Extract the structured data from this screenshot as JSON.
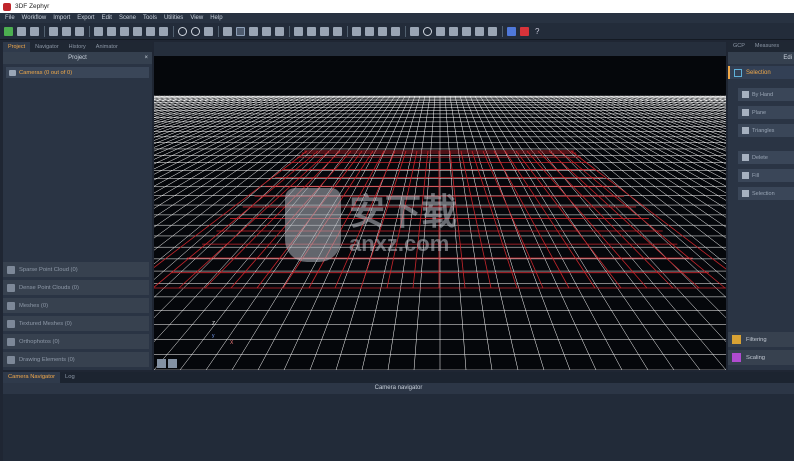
{
  "window": {
    "title": "3DF Zephyr"
  },
  "menu": [
    "File",
    "Workflow",
    "Import",
    "Export",
    "Edit",
    "Scene",
    "Tools",
    "Utilities",
    "View",
    "Help"
  ],
  "left_panel": {
    "tabs": [
      "Project",
      "Navigator",
      "History",
      "Animator"
    ],
    "active_tab": "Project",
    "title": "Project",
    "close": "×",
    "camera_item": "Cameras (0 out of 0)",
    "items": [
      {
        "label": "Sparse Point Cloud (0)",
        "icon": "sparse-cloud-icon"
      },
      {
        "label": "Dense Point Clouds (0)",
        "icon": "dense-cloud-icon"
      },
      {
        "label": "Meshes (0)",
        "icon": "mesh-icon"
      },
      {
        "label": "Textured Meshes (0)",
        "icon": "textured-mesh-icon"
      },
      {
        "label": "Orthophotos (0)",
        "icon": "orthophoto-icon"
      },
      {
        "label": "Drawing Elements (0)",
        "icon": "drawing-icon"
      }
    ]
  },
  "right_panel": {
    "tabs": [
      "GCP",
      "Measures"
    ],
    "header": "Edi",
    "selection_label": "Selection",
    "buttons_a": [
      "By Hand",
      "Plane",
      "Triangles"
    ],
    "buttons_b": [
      "Delete",
      "Fill",
      "Selection"
    ],
    "bottom": [
      "Filtering",
      "Scaling"
    ]
  },
  "viewport": {
    "axes": {
      "z": "Z",
      "y": "y",
      "x": "X"
    }
  },
  "bottom_panel": {
    "tabs": [
      "Camera Navigator",
      "Log"
    ],
    "active_tab": "Camera Navigator",
    "title": "Camera navigator"
  },
  "watermark": {
    "main": "安下载",
    "sub": "anxz.com"
  },
  "colors": {
    "accent": "#f0a94a",
    "grid": "#ffffff",
    "grid_red": "#c8262c",
    "bg": "#1f2633"
  }
}
